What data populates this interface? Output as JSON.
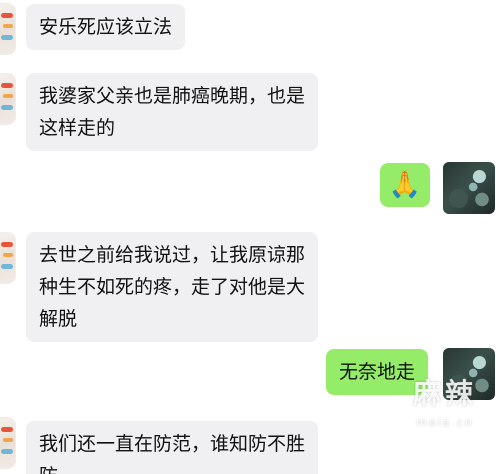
{
  "messages": [
    {
      "side": "left",
      "text": "安乐死应该立法"
    },
    {
      "side": "left",
      "lines": [
        "我婆家父亲也是肺癌晚期，也是",
        "这样走的"
      ]
    },
    {
      "side": "right",
      "emoji": "🙏"
    },
    {
      "side": "left",
      "lines": [
        "去世之前给我说过，让我原谅那",
        "种生不如死的疼，走了对他是大",
        "解脱"
      ]
    },
    {
      "side": "right",
      "text": "无奈地走"
    },
    {
      "side": "left",
      "lines": [
        "我们还一直在防范，谁知防不胜",
        "防"
      ]
    }
  ],
  "watermark": {
    "main": "麻辣",
    "sub": "mala.cn"
  }
}
